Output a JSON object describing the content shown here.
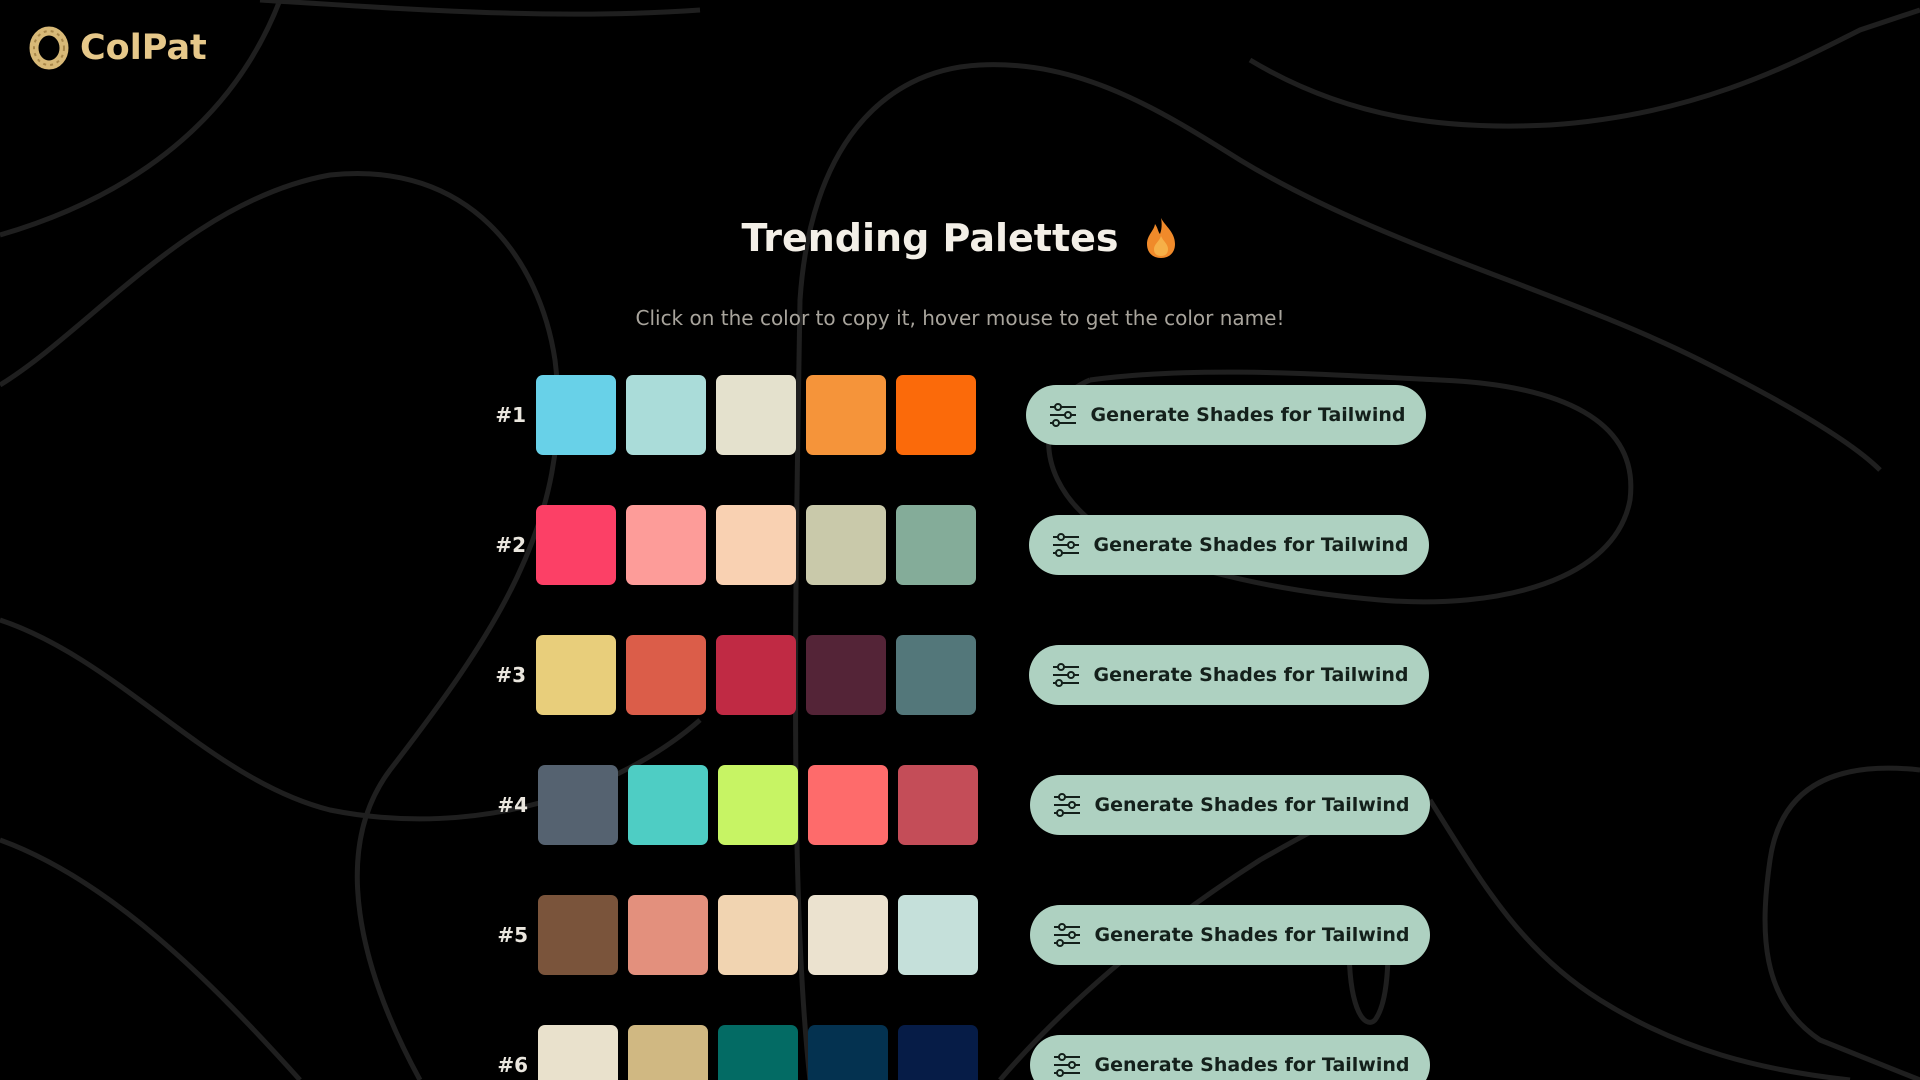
{
  "app": {
    "logo_text": "ColPat",
    "logo_icon": "ring-logo-icon",
    "accent_color": "#e6c88a"
  },
  "header": {
    "title": "Trending Palettes",
    "title_icon": "fire-icon",
    "subtitle": "Click on the color to copy it, hover mouse to get the color name!"
  },
  "button_label": "Generate Shades for Tailwind",
  "button_icon": "sliders-icon",
  "palettes": [
    {
      "rank": "#1",
      "colors": [
        "#68d1e8",
        "#aadcd9",
        "#e4e1cd",
        "#f5943a",
        "#fb6a0a"
      ]
    },
    {
      "rank": "#2",
      "colors": [
        "#fc4066",
        "#fd9c99",
        "#f9d1b2",
        "#c9c9aa",
        "#84ac99"
      ]
    },
    {
      "rank": "#3",
      "colors": [
        "#e8ce7b",
        "#db5d49",
        "#c02a44",
        "#542437",
        "#53777a"
      ]
    },
    {
      "rank": "#4",
      "colors": [
        "#556270",
        "#4ecdc4",
        "#c7f464",
        "#fe6b6b",
        "#c44d58"
      ]
    },
    {
      "rank": "#5",
      "colors": [
        "#7a543b",
        "#e3907d",
        "#f1d4b1",
        "#ebe2cf",
        "#c5e0da"
      ]
    },
    {
      "rank": "#6",
      "colors": [
        "#e9e1cc",
        "#d0b882",
        "#036b64",
        "#043250",
        "#061c47"
      ]
    }
  ]
}
